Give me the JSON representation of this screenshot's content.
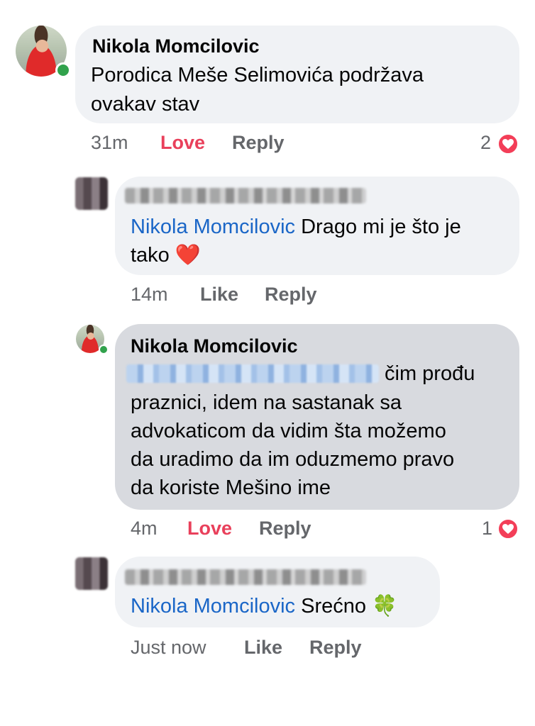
{
  "comments": [
    {
      "author": "Nikola Momcilovic",
      "text_line1": "Porodica Meše Selimovića podržava",
      "text_line2": "ovakav stav",
      "time": "31m",
      "action1": "Love",
      "action2": "Reply",
      "reaction_count": "2",
      "reaction_icon": "heart-icon"
    },
    {
      "author_hidden": true,
      "mention": "Nikola Momcilovic",
      "text_line1": " Drago mi je što je",
      "text_line2": "tako",
      "emoji": "❤️",
      "time": "14m",
      "action1": "Like",
      "action2": "Reply"
    },
    {
      "author": "Nikola Momcilovic",
      "text_line1_after_mention": "čim prođu",
      "text_line2": "praznici, idem na sastanak sa",
      "text_line3": "advokaticom da vidim šta možemo",
      "text_line4": "da uradimo da im oduzmemo pravo",
      "text_line5": "da koriste Mešino ime",
      "time": "4m",
      "action1": "Love",
      "action2": "Reply",
      "reaction_count": "1",
      "reaction_icon": "heart-icon"
    },
    {
      "author_hidden": true,
      "mention": "Nikola Momcilovic",
      "text": " Srećno",
      "emoji": "🍀",
      "time": "Just now",
      "action1": "Like",
      "action2": "Reply"
    }
  ],
  "colors": {
    "bubble": "#f0f2f5",
    "bubble_selected": "#d8dadf",
    "mention": "#1a66c7",
    "love": "#e9405b",
    "meta": "#65676b",
    "online": "#31a24c"
  }
}
